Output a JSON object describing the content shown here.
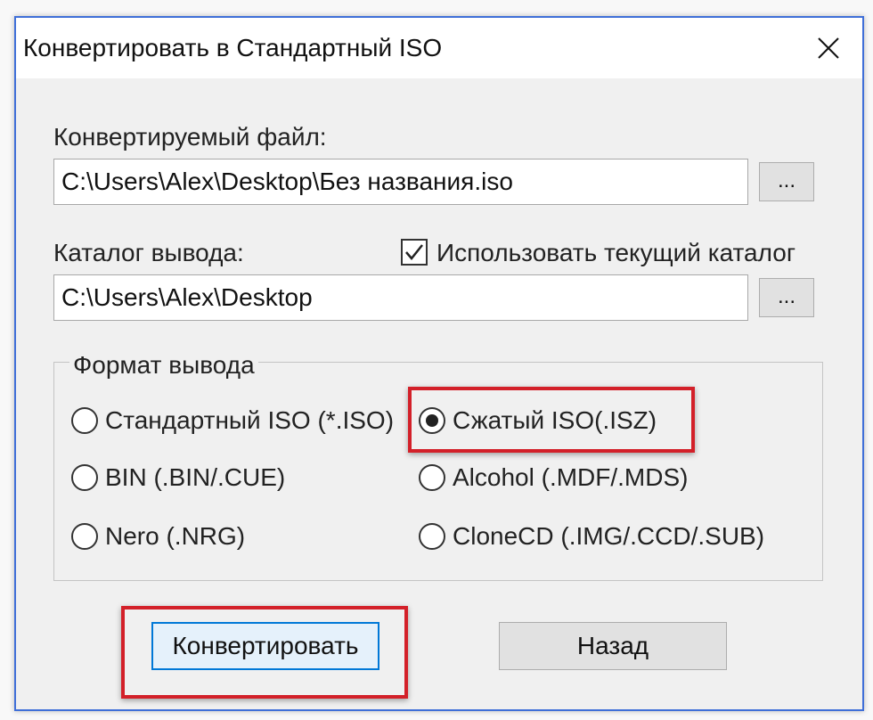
{
  "window": {
    "title": "Конвертировать в Стандартный ISO"
  },
  "source": {
    "label": "Конвертируемый файл:",
    "value": "C:\\Users\\Alex\\Desktop\\Без названия.iso",
    "browse_label": "..."
  },
  "output": {
    "label": "Каталог вывода:",
    "use_current_label": "Использовать текущий каталог",
    "use_current_checked": true,
    "value": "C:\\Users\\Alex\\Desktop",
    "browse_label": "..."
  },
  "format": {
    "legend": "Формат вывода",
    "options": [
      {
        "label": "Стандартный ISO (*.ISO)",
        "selected": false
      },
      {
        "label": "Сжатый ISO(.ISZ)",
        "selected": true
      },
      {
        "label": "BIN (.BIN/.CUE)",
        "selected": false
      },
      {
        "label": "Alcohol (.MDF/.MDS)",
        "selected": false
      },
      {
        "label": "Nero (.NRG)",
        "selected": false
      },
      {
        "label": "CloneCD (.IMG/.CCD/.SUB)",
        "selected": false
      }
    ]
  },
  "actions": {
    "convert_label": "Конвертировать",
    "back_label": "Назад"
  },
  "colors": {
    "highlight": "#d32029",
    "dialog_border": "#3f6fd8",
    "default_button_border": "#0078d7"
  },
  "icons": {
    "close": "close-icon",
    "check": "checkmark-icon"
  }
}
